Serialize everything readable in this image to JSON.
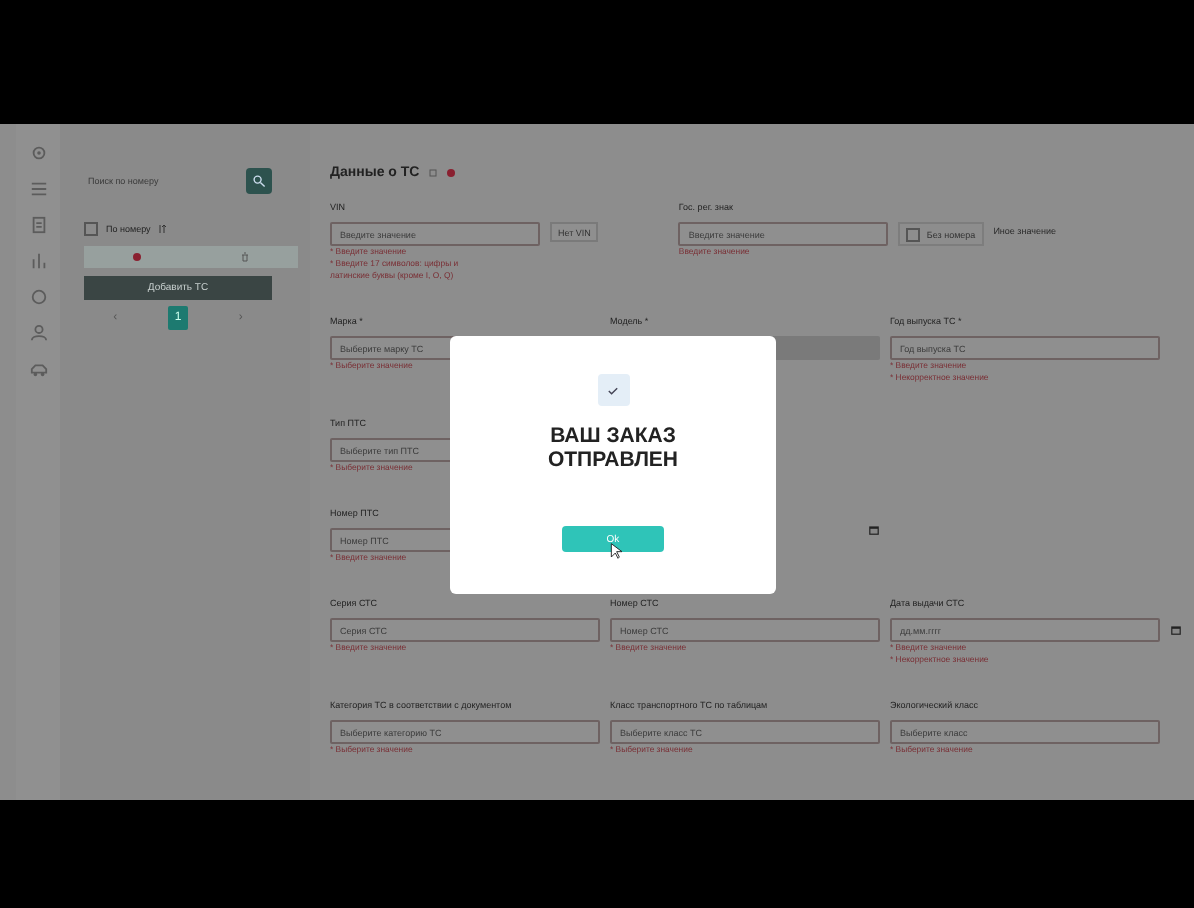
{
  "sidebar": {
    "search": {
      "placeholder": "Поиск по номеру"
    },
    "filter": {
      "label": "По номеру",
      "checked": false
    },
    "add_button": "Добавить ТС",
    "pagination": [
      {
        "label": "‹",
        "selected": false
      },
      {
        "label": "1",
        "selected": true
      },
      {
        "label": "›",
        "selected": false
      }
    ]
  },
  "form": {
    "title": "Данные о ТС",
    "rows": [
      [
        {
          "kind": "field",
          "label": "VIN",
          "placeholder": "Введите значение",
          "errors": [
            "* Введите значение",
            "* Введите 17 символов: цифры и",
            "латинские буквы (кроме I, O, Q)"
          ]
        },
        {
          "kind": "button",
          "label": "Нет VIN"
        },
        {
          "kind": "field",
          "label": "Гос. рег. знак",
          "placeholder": "Введите значение",
          "errors": [
            "Введите значение"
          ]
        },
        {
          "kind": "checkbox",
          "label": "Без номера",
          "checked": false
        },
        {
          "kind": "link",
          "label": "Иное значение"
        }
      ],
      [
        {
          "kind": "select",
          "label": "Марка *",
          "placeholder": "Выберите марку ТС",
          "errors": [
            "* Выберите значение"
          ]
        },
        {
          "kind": "select",
          "label": "Модель *",
          "disabled": true
        },
        {
          "kind": "field",
          "label": "Год выпуска ТС *",
          "placeholder": "Год выпуска ТС",
          "errors": [
            "* Введите значение",
            "* Некорректное значение"
          ]
        }
      ],
      [
        {
          "kind": "select",
          "label": "Тип ПТС",
          "placeholder": "Выберите тип ПТС",
          "errors": [
            "* Выберите значение"
          ]
        }
      ],
      [
        {
          "kind": "field",
          "label": "Номер ПТС",
          "placeholder": "Номер ПТС",
          "errors": [
            "* Введите значение"
          ]
        },
        {
          "kind": "calendar"
        }
      ],
      [
        {
          "kind": "field",
          "label": "Серия СТС",
          "placeholder": "Серия СТС",
          "errors": [
            "* Введите значение"
          ]
        },
        {
          "kind": "field",
          "label": "Номер СТС",
          "placeholder": "Номер СТС",
          "errors": [
            "* Введите значение"
          ]
        },
        {
          "kind": "date",
          "label": "Дата выдачи СТС",
          "placeholder": "дд.мм.гггг",
          "errors": [
            "* Введите значение",
            "* Некорректное значение"
          ]
        }
      ],
      [
        {
          "kind": "select",
          "label": "Категория ТС в соответствии с документом",
          "placeholder": "Выберите категорию ТС",
          "errors": [
            "* Выберите значение"
          ]
        },
        {
          "kind": "select",
          "label": "Класс транспортного ТС по таблицам",
          "placeholder": "Выберите класс ТС",
          "errors": [
            "* Выберите значение"
          ]
        },
        {
          "kind": "select",
          "label": "Экологический класс",
          "placeholder": "Выберите класс",
          "errors": [
            "* Выберите значение"
          ]
        }
      ]
    ]
  },
  "modal": {
    "message": "ВАШ ЗАКАЗ ОТПРАВЛЕН",
    "button": "Ok"
  }
}
